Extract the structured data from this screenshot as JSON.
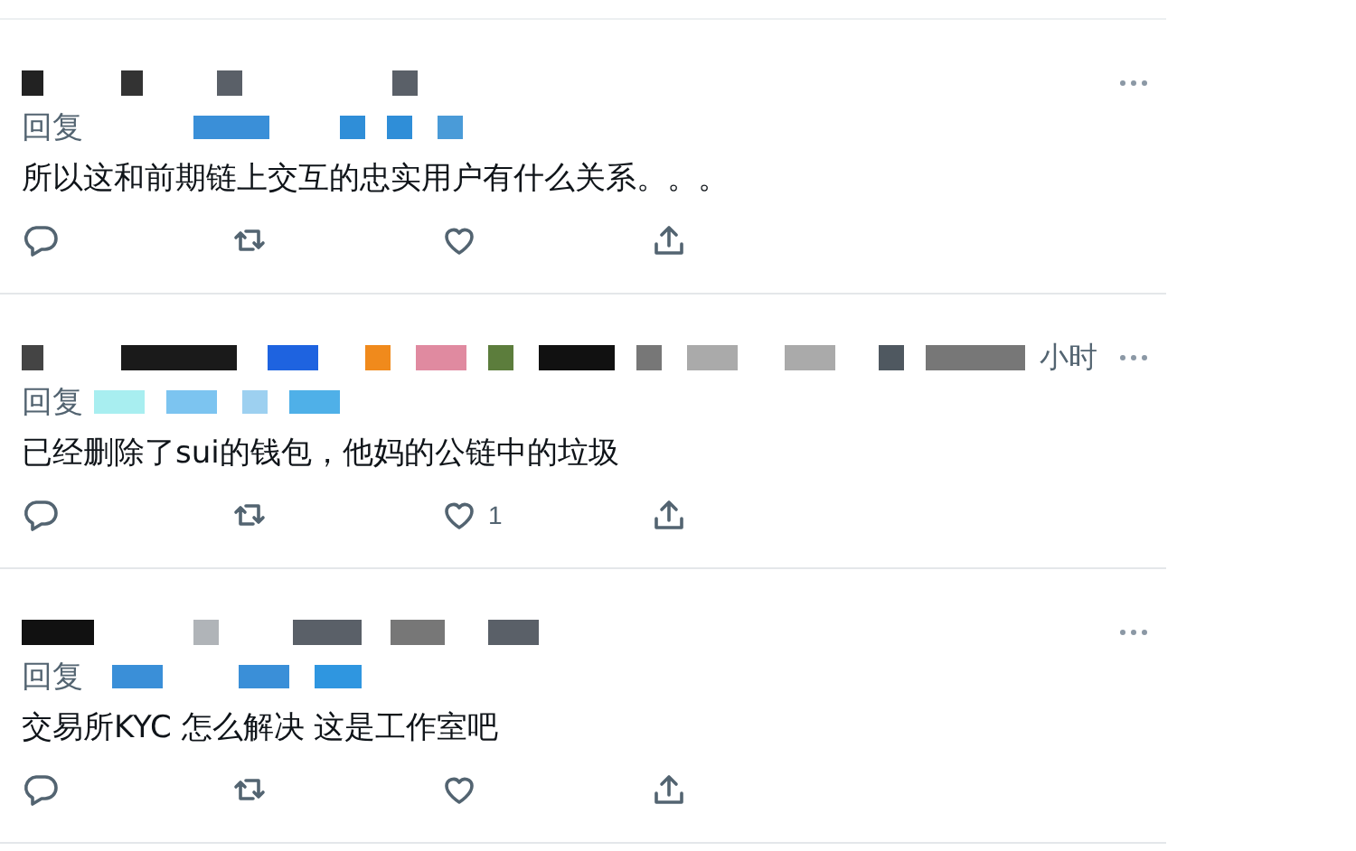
{
  "replies": [
    {
      "reply_label": "回复",
      "text": "所以这和前期链上交互的忠实用户有什么关系。。。",
      "actions": [
        {
          "kind": "reply"
        },
        {
          "kind": "retweet"
        },
        {
          "kind": "like"
        },
        {
          "kind": "share"
        }
      ]
    },
    {
      "reply_label": "回复",
      "time": "小时",
      "text": "已经删除了sui的钱包，他妈的公链中的垃圾",
      "actions": [
        {
          "kind": "reply"
        },
        {
          "kind": "retweet"
        },
        {
          "kind": "like",
          "count": "1"
        },
        {
          "kind": "share"
        }
      ]
    },
    {
      "reply_label": "回复",
      "text": "交易所KYC 怎么解决  这是工作室吧",
      "actions": [
        {
          "kind": "reply"
        },
        {
          "kind": "retweet"
        },
        {
          "kind": "like"
        },
        {
          "kind": "share"
        }
      ]
    }
  ]
}
